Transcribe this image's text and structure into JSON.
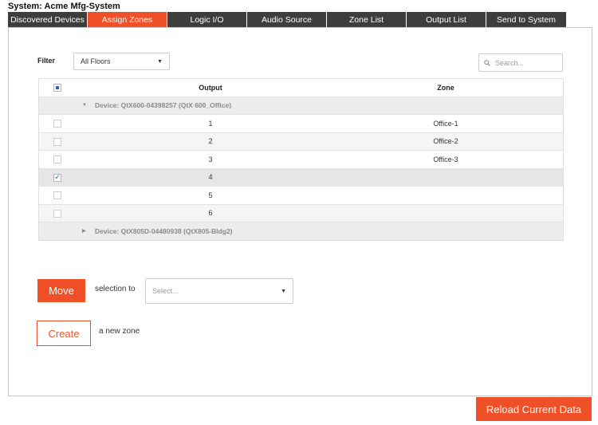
{
  "system": {
    "title": "System: Acme Mfg-System"
  },
  "tabs": [
    {
      "label": "Discovered Devices"
    },
    {
      "label": "Assign Zones"
    },
    {
      "label": "Logic I/O"
    },
    {
      "label": "Audio Source"
    },
    {
      "label": "Zone List"
    },
    {
      "label": "Output List"
    },
    {
      "label": "Send to System"
    }
  ],
  "active_tab": "Assign Zones",
  "filter": {
    "label": "Filter",
    "value": "All Floors"
  },
  "search": {
    "placeholder": "Search..."
  },
  "grid": {
    "headers": {
      "output": "Output",
      "zone": "Zone"
    },
    "groups": [
      {
        "label": "Device: QtX600-04398257 (QtX 600_Office)",
        "expanded": true,
        "rows": [
          {
            "output": "1",
            "zone": "Office-1",
            "checked": false
          },
          {
            "output": "2",
            "zone": "Office-2",
            "checked": false
          },
          {
            "output": "3",
            "zone": "Office-3",
            "checked": false
          },
          {
            "output": "4",
            "zone": "",
            "checked": true
          },
          {
            "output": "5",
            "zone": "",
            "checked": false
          },
          {
            "output": "6",
            "zone": "",
            "checked": false
          }
        ]
      },
      {
        "label": "Device: QtX805D-04480938 (QtX805-Bldg2)",
        "expanded": false,
        "rows": []
      }
    ]
  },
  "move": {
    "button_label": "Move",
    "text": "selection to",
    "select_placeholder": "Select..."
  },
  "create": {
    "button_label": "Create",
    "text": "a new zone"
  },
  "reload": {
    "button_label": "Reload Current Data"
  },
  "colors": {
    "accent": "#f05028",
    "tab_bg": "#3d3d3d",
    "check": "#2b5fb8"
  }
}
